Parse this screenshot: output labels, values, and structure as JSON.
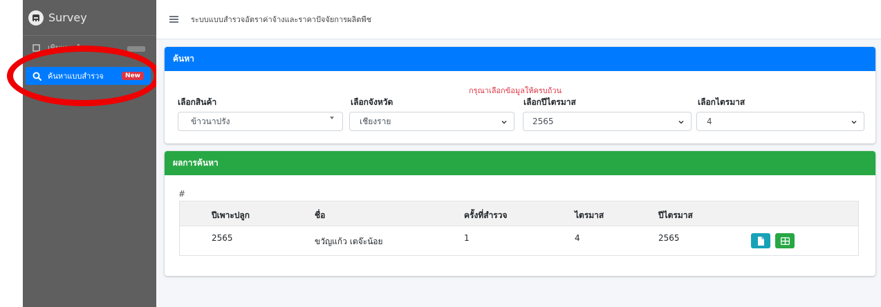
{
  "app": {
    "brand": "Survey",
    "title": "ระบบแบบสำรวจอัตราค่าจ้างและราคาปัจจัยการผลิตพืช"
  },
  "sidebar": {
    "items": [
      {
        "label": "เพิ่มแบบสำรวจ",
        "icon": "edit-icon"
      },
      {
        "label": "ค้นหาแบบสำรวจ",
        "icon": "search-icon",
        "badge": "New",
        "active": true
      }
    ]
  },
  "search_card": {
    "header": "ค้นหา",
    "warning": "กรุณาเลือกข้อมูลให้ครบถ้วน",
    "fields": [
      {
        "label": "เลือกสินค้า",
        "value": "ข้าวนาปรัง"
      },
      {
        "label": "เลือกจังหวัด",
        "value": "เชียงราย"
      },
      {
        "label": "เลือกปีไตรมาส",
        "value": "2565"
      },
      {
        "label": "เลือกไตรมาส",
        "value": "4"
      }
    ]
  },
  "result_card": {
    "header": "ผลการค้นหา",
    "hash": "#",
    "columns": [
      "ปีเพาะปลูก",
      "ชื่อ",
      "ครั้งที่สำรวจ",
      "ไตรมาส",
      "ปีไตรมาส"
    ],
    "rows": [
      {
        "year": "2565",
        "name": "ขวัญแก้ว เตจ๊ะน้อย",
        "round": "1",
        "quarter": "4",
        "quarter_year": "2565"
      }
    ]
  },
  "colors": {
    "primary": "#007bff",
    "success": "#28a745",
    "info": "#17a2b8",
    "danger": "#dc3545",
    "sidebar": "#5f5f5f",
    "annotation": "#ee0000"
  }
}
